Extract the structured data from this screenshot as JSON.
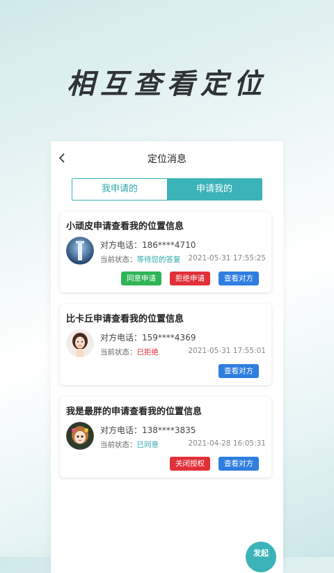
{
  "headline": "相互查看定位",
  "nav": {
    "title": "定位消息"
  },
  "tabs": [
    {
      "label": "我申请的",
      "active": false
    },
    {
      "label": "申请我的",
      "active": true
    }
  ],
  "cards": [
    {
      "title": "小顽皮申请查看我的位置信息",
      "phone_label": "对方电话：",
      "phone": "186****4710",
      "status_label": "当前状态：",
      "status": "等待您的答复",
      "status_color": "#2aa7ad",
      "time": "2021-05-31 17:55:25",
      "buttons": [
        "同意申请",
        "拒绝申请",
        "查看对方"
      ]
    },
    {
      "title": "比卡丘申请查看我的位置信息",
      "phone_label": "对方电话：",
      "phone": "159****4369",
      "status_label": "当前状态：",
      "status": "已拒绝",
      "status_color": "#e0303a",
      "time": "2021-05-31 17:55:01",
      "buttons": [
        "查看对方"
      ]
    },
    {
      "title": "我是最胖的申请查看我的位置信息",
      "phone_label": "对方电话：",
      "phone": "138****3835",
      "status_label": "当前状态：",
      "status": "已同意",
      "status_color": "#2aa7ad",
      "time": "2021-04-28 16:05:31",
      "buttons": [
        "关闭授权",
        "查看对方"
      ]
    }
  ],
  "fab": {
    "label": "发起"
  }
}
